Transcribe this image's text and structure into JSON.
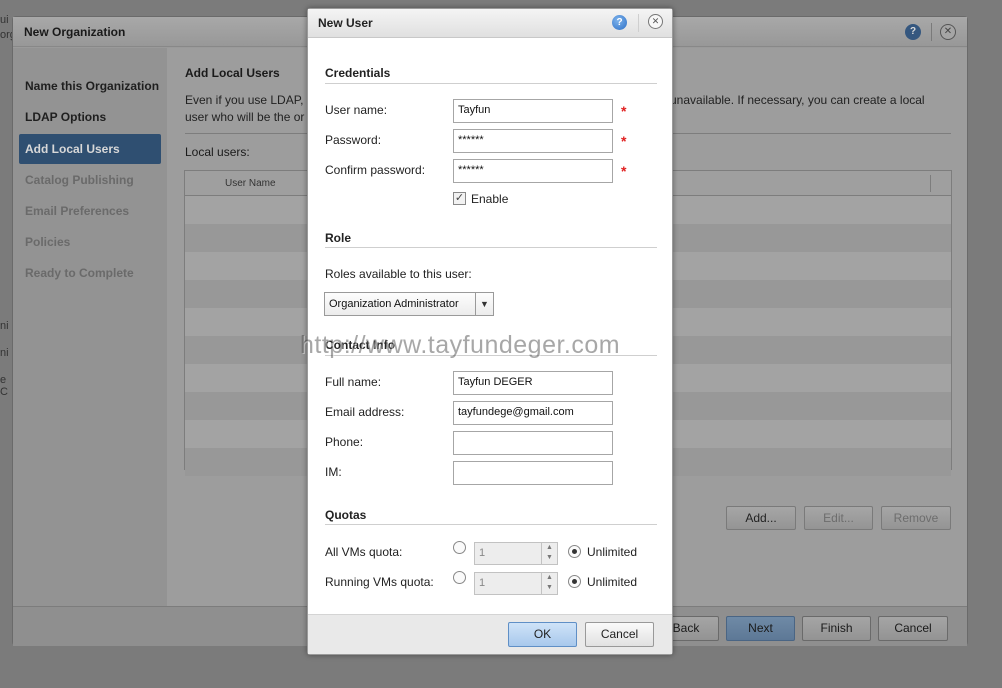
{
  "background_fragments": [
    "ui",
    "org",
    "ni",
    "ni",
    "e C"
  ],
  "wizard": {
    "title": "New Organization",
    "steps": [
      {
        "label": "Name this Organization",
        "state": "done"
      },
      {
        "label": "LDAP Options",
        "state": "done"
      },
      {
        "label": "Add Local Users",
        "state": "active"
      },
      {
        "label": "Catalog Publishing",
        "state": "pending"
      },
      {
        "label": "Email Preferences",
        "state": "pending"
      },
      {
        "label": "Policies",
        "state": "pending"
      },
      {
        "label": "Ready to Complete",
        "state": "pending"
      }
    ],
    "heading": "Add Local Users",
    "description_line1_start": "Even if you use LDAP,",
    "description_line1_end": "unavailable. If necessary, you can create a local",
    "description_line2": "user who will be the or",
    "local_users_label": "Local users:",
    "table_header": "User Name",
    "buttons": {
      "add": "Add...",
      "edit": "Edit...",
      "remove": "Remove"
    },
    "footer": {
      "back": "Back",
      "next": "Next",
      "finish": "Finish",
      "cancel": "Cancel"
    }
  },
  "dialog": {
    "title": "New User",
    "credentials": {
      "title": "Credentials",
      "username_label": "User name:",
      "username_value": "Tayfun",
      "password_label": "Password:",
      "password_value": "******",
      "confirm_label": "Confirm password:",
      "confirm_value": "******",
      "enable_label": "Enable",
      "enable_checked": true,
      "required_mark": "*"
    },
    "role": {
      "title": "Role",
      "roles_label": "Roles available to this user:",
      "selected_role": "Organization Administrator"
    },
    "contact": {
      "title": "Contact Info",
      "fullname_label": "Full name:",
      "fullname_value": "Tayfun DEGER",
      "email_label": "Email address:",
      "email_value": "tayfundege@gmail.com",
      "phone_label": "Phone:",
      "phone_value": "",
      "im_label": "IM:",
      "im_value": ""
    },
    "quotas": {
      "title": "Quotas",
      "all_vms_label": "All VMs quota:",
      "all_vms_value": "1",
      "running_vms_label": "Running VMs quota:",
      "running_vms_value": "1",
      "unlimited_label": "Unlimited"
    },
    "ok": "OK",
    "cancel": "Cancel"
  },
  "watermark": "http://www.tayfundeger.com"
}
